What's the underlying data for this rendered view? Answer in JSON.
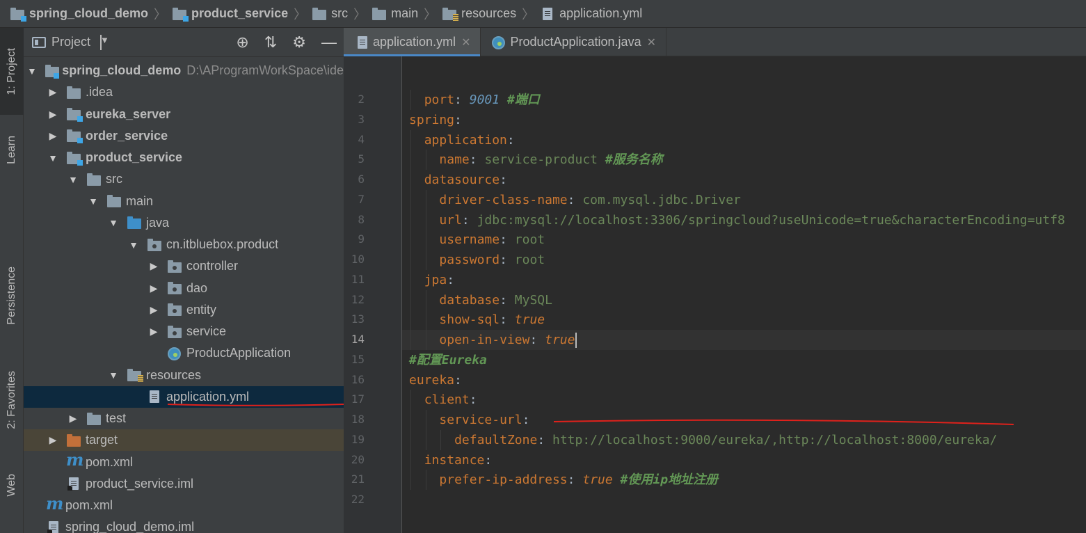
{
  "breadcrumb": [
    {
      "label": "spring_cloud_demo",
      "icon": "module-folder-icon",
      "bold": true
    },
    {
      "label": "product_service",
      "icon": "module-folder-icon",
      "bold": true
    },
    {
      "label": "src",
      "icon": "folder-icon",
      "bold": false
    },
    {
      "label": "main",
      "icon": "folder-icon",
      "bold": false
    },
    {
      "label": "resources",
      "icon": "resources-folder-icon",
      "bold": false
    },
    {
      "label": "application.yml",
      "icon": "yaml-file-icon",
      "bold": false
    }
  ],
  "stripe": {
    "project": "1: Project",
    "learn": "Learn",
    "persistence": "Persistence",
    "favorites": "2: Favorites",
    "web": "Web"
  },
  "project_panel": {
    "title": "Project",
    "tree": [
      {
        "label": "spring_cloud_demo",
        "path": "D:\\AProgramWorkSpace\\ide",
        "icon": "module",
        "arrow": "down",
        "bold": true
      },
      {
        "label": ".idea",
        "icon": "folder",
        "arrow": "right",
        "bold": false
      },
      {
        "label": "eureka_server",
        "icon": "module",
        "arrow": "right",
        "bold": true
      },
      {
        "label": "order_service",
        "icon": "module",
        "arrow": "right",
        "bold": true
      },
      {
        "label": "product_service",
        "icon": "module",
        "arrow": "down",
        "bold": true
      },
      {
        "label": "src",
        "icon": "folder",
        "arrow": "down",
        "bold": false
      },
      {
        "label": "main",
        "icon": "folder",
        "arrow": "down",
        "bold": false
      },
      {
        "label": "java",
        "icon": "source",
        "arrow": "down",
        "bold": false
      },
      {
        "label": "cn.itbluebox.product",
        "icon": "package",
        "arrow": "down",
        "bold": false
      },
      {
        "label": "controller",
        "icon": "package",
        "arrow": "right",
        "bold": false
      },
      {
        "label": "dao",
        "icon": "package",
        "arrow": "right",
        "bold": false
      },
      {
        "label": "entity",
        "icon": "package",
        "arrow": "right",
        "bold": false
      },
      {
        "label": "service",
        "icon": "package",
        "arrow": "right",
        "bold": false
      },
      {
        "label": "ProductApplication",
        "icon": "spring-boot",
        "arrow": "none",
        "bold": false
      },
      {
        "label": "resources",
        "icon": "resources",
        "arrow": "down",
        "bold": false
      },
      {
        "label": "application.yml",
        "icon": "yaml",
        "arrow": "none",
        "bold": false,
        "selected": true
      },
      {
        "label": "test",
        "icon": "folder",
        "arrow": "right",
        "bold": false
      },
      {
        "label": "target",
        "icon": "excluded",
        "arrow": "right",
        "bold": false,
        "excluded": true
      },
      {
        "label": "pom.xml",
        "icon": "maven",
        "arrow": "none",
        "bold": false
      },
      {
        "label": "product_service.iml",
        "icon": "iml",
        "arrow": "none",
        "bold": false
      },
      {
        "label": "pom.xml",
        "icon": "maven",
        "arrow": "none",
        "bold": false
      },
      {
        "label": "spring_cloud_demo.iml",
        "icon": "iml",
        "arrow": "none",
        "bold": false
      }
    ]
  },
  "tabs": [
    {
      "label": "application.yml",
      "active": true,
      "icon": "yaml-file-icon"
    },
    {
      "label": "ProductApplication.java",
      "active": false,
      "icon": "spring-boot-icon"
    }
  ],
  "editor": {
    "current_line": 14,
    "lines": [
      {
        "n": "2",
        "indent": 1,
        "segs": [
          [
            "k",
            "port"
          ],
          [
            "p",
            ": "
          ],
          [
            "num",
            "9001"
          ],
          [
            "p",
            " "
          ],
          [
            "c",
            "#端口"
          ]
        ]
      },
      {
        "n": "3",
        "indent": 0,
        "segs": [
          [
            "k",
            "spring"
          ],
          [
            "p",
            ":"
          ]
        ]
      },
      {
        "n": "4",
        "indent": 1,
        "segs": [
          [
            "k",
            "application"
          ],
          [
            "p",
            ":"
          ]
        ]
      },
      {
        "n": "5",
        "indent": 2,
        "segs": [
          [
            "k",
            "name"
          ],
          [
            "p",
            ": "
          ],
          [
            "v",
            "service-product"
          ],
          [
            "p",
            " "
          ],
          [
            "c",
            "#服务名称"
          ]
        ]
      },
      {
        "n": "6",
        "indent": 1,
        "segs": [
          [
            "k",
            "datasource"
          ],
          [
            "p",
            ":"
          ]
        ]
      },
      {
        "n": "7",
        "indent": 2,
        "segs": [
          [
            "k",
            "driver-class-name"
          ],
          [
            "p",
            ": "
          ],
          [
            "v",
            "com.mysql.jdbc.Driver"
          ]
        ]
      },
      {
        "n": "8",
        "indent": 2,
        "segs": [
          [
            "k",
            "url"
          ],
          [
            "p",
            ": "
          ],
          [
            "v",
            "jdbc:mysql://localhost:3306/springcloud?useUnicode=true&characterEncoding=utf8"
          ]
        ]
      },
      {
        "n": "9",
        "indent": 2,
        "segs": [
          [
            "k",
            "username"
          ],
          [
            "p",
            ": "
          ],
          [
            "v",
            "root"
          ]
        ]
      },
      {
        "n": "10",
        "indent": 2,
        "segs": [
          [
            "k",
            "password"
          ],
          [
            "p",
            ": "
          ],
          [
            "v",
            "root"
          ]
        ]
      },
      {
        "n": "11",
        "indent": 1,
        "segs": [
          [
            "k",
            "jpa"
          ],
          [
            "p",
            ":"
          ]
        ]
      },
      {
        "n": "12",
        "indent": 2,
        "segs": [
          [
            "k",
            "database"
          ],
          [
            "p",
            ": "
          ],
          [
            "v",
            "MySQL"
          ]
        ]
      },
      {
        "n": "13",
        "indent": 2,
        "segs": [
          [
            "k",
            "show-sql"
          ],
          [
            "p",
            ": "
          ],
          [
            "b",
            "true"
          ]
        ]
      },
      {
        "n": "14",
        "indent": 2,
        "segs": [
          [
            "k",
            "open-in-view"
          ],
          [
            "p",
            ": "
          ],
          [
            "b",
            "true"
          ]
        ],
        "caret": true
      },
      {
        "n": "15",
        "indent": 0,
        "segs": [
          [
            "c",
            "#配置Eureka"
          ]
        ]
      },
      {
        "n": "16",
        "indent": 0,
        "segs": [
          [
            "k",
            "eureka"
          ],
          [
            "p",
            ":"
          ]
        ]
      },
      {
        "n": "17",
        "indent": 1,
        "segs": [
          [
            "k",
            "client"
          ],
          [
            "p",
            ":"
          ]
        ]
      },
      {
        "n": "18",
        "indent": 2,
        "segs": [
          [
            "k",
            "service-url"
          ],
          [
            "p",
            ":"
          ]
        ]
      },
      {
        "n": "19",
        "indent": 3,
        "segs": [
          [
            "k",
            "defaultZone"
          ],
          [
            "p",
            ": "
          ],
          [
            "v",
            "http://localhost:9000/eureka/,http://localhost:8000/eureka/"
          ]
        ]
      },
      {
        "n": "20",
        "indent": 1,
        "segs": [
          [
            "k",
            "instance"
          ],
          [
            "p",
            ":"
          ]
        ]
      },
      {
        "n": "21",
        "indent": 2,
        "segs": [
          [
            "k",
            "prefer-ip-address"
          ],
          [
            "p",
            ": "
          ],
          [
            "b",
            "true"
          ],
          [
            "p",
            " "
          ],
          [
            "c",
            "#使用ip地址注册"
          ]
        ]
      },
      {
        "n": "22",
        "indent": 0,
        "segs": []
      }
    ]
  },
  "colors": {
    "keyword": "#cc7832",
    "string": "#6a8759",
    "number": "#6897bb",
    "comment": "#629755",
    "annotation_underline": "#e0211b",
    "selection": "#0d293e"
  }
}
